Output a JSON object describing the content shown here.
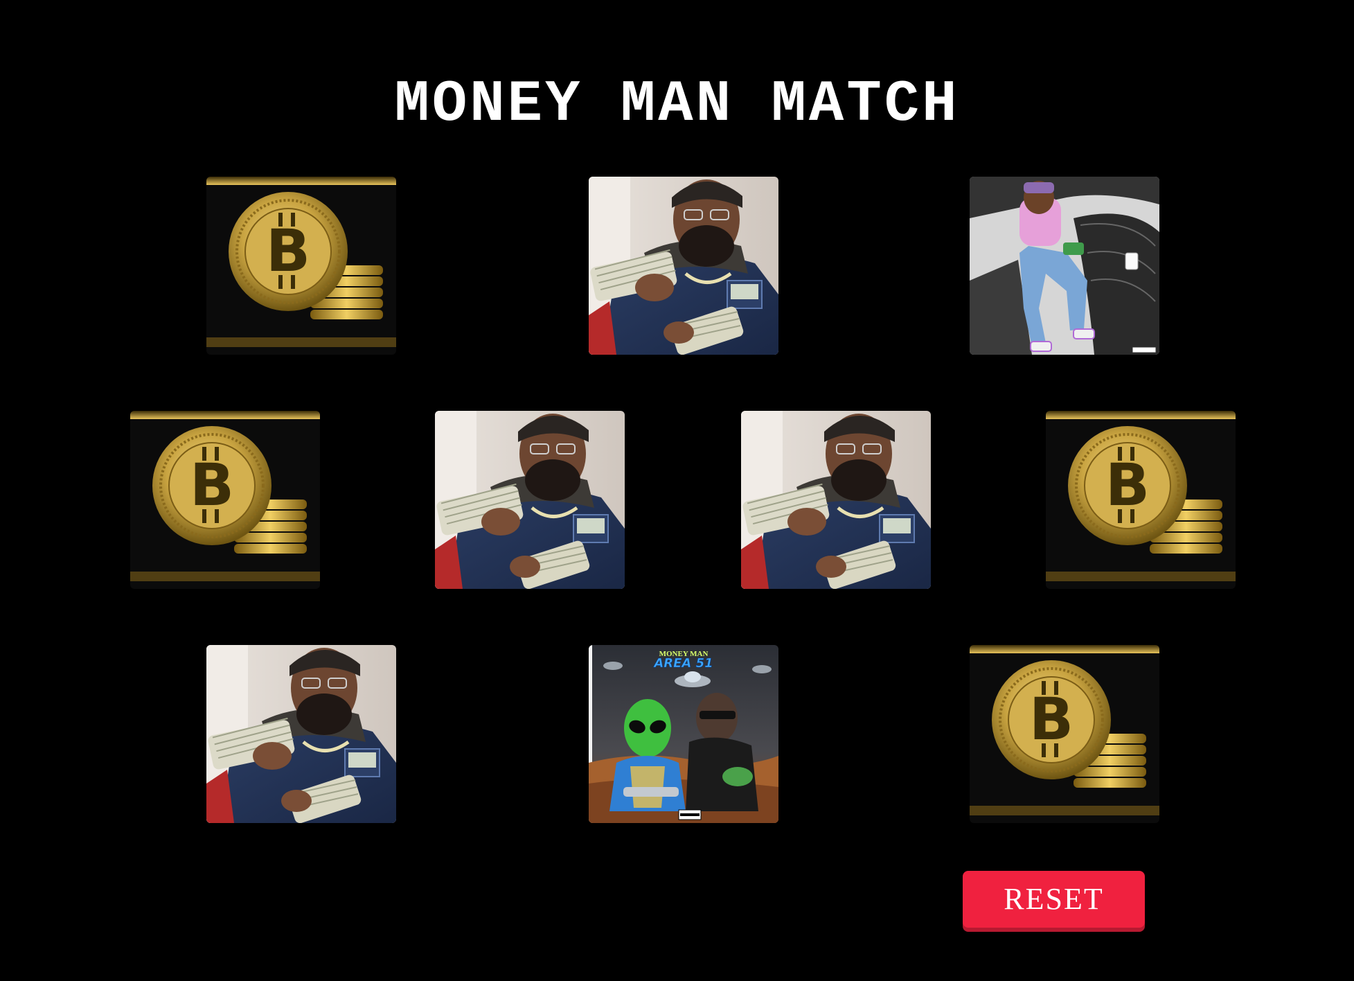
{
  "game": {
    "title": "MONEY MAN MATCH",
    "reset_label": "RESET"
  },
  "album_cover": {
    "artist_text": "MONEY MAN",
    "album_text": "AREA 51"
  },
  "cards": [
    {
      "row": 1,
      "image": "bitcoin-coin"
    },
    {
      "row": 1,
      "image": "man-with-cash"
    },
    {
      "row": 1,
      "image": "car-illustration"
    },
    {
      "row": 2,
      "image": "bitcoin-coin"
    },
    {
      "row": 2,
      "image": "man-with-cash"
    },
    {
      "row": 2,
      "image": "man-with-cash"
    },
    {
      "row": 2,
      "image": "bitcoin-coin"
    },
    {
      "row": 3,
      "image": "man-with-cash"
    },
    {
      "row": 3,
      "image": "area-51-album-cover"
    },
    {
      "row": 3,
      "image": "bitcoin-coin"
    }
  ],
  "colors": {
    "background": "#000000",
    "reset_button": "#f0213f",
    "title_text": "#ffffff"
  }
}
